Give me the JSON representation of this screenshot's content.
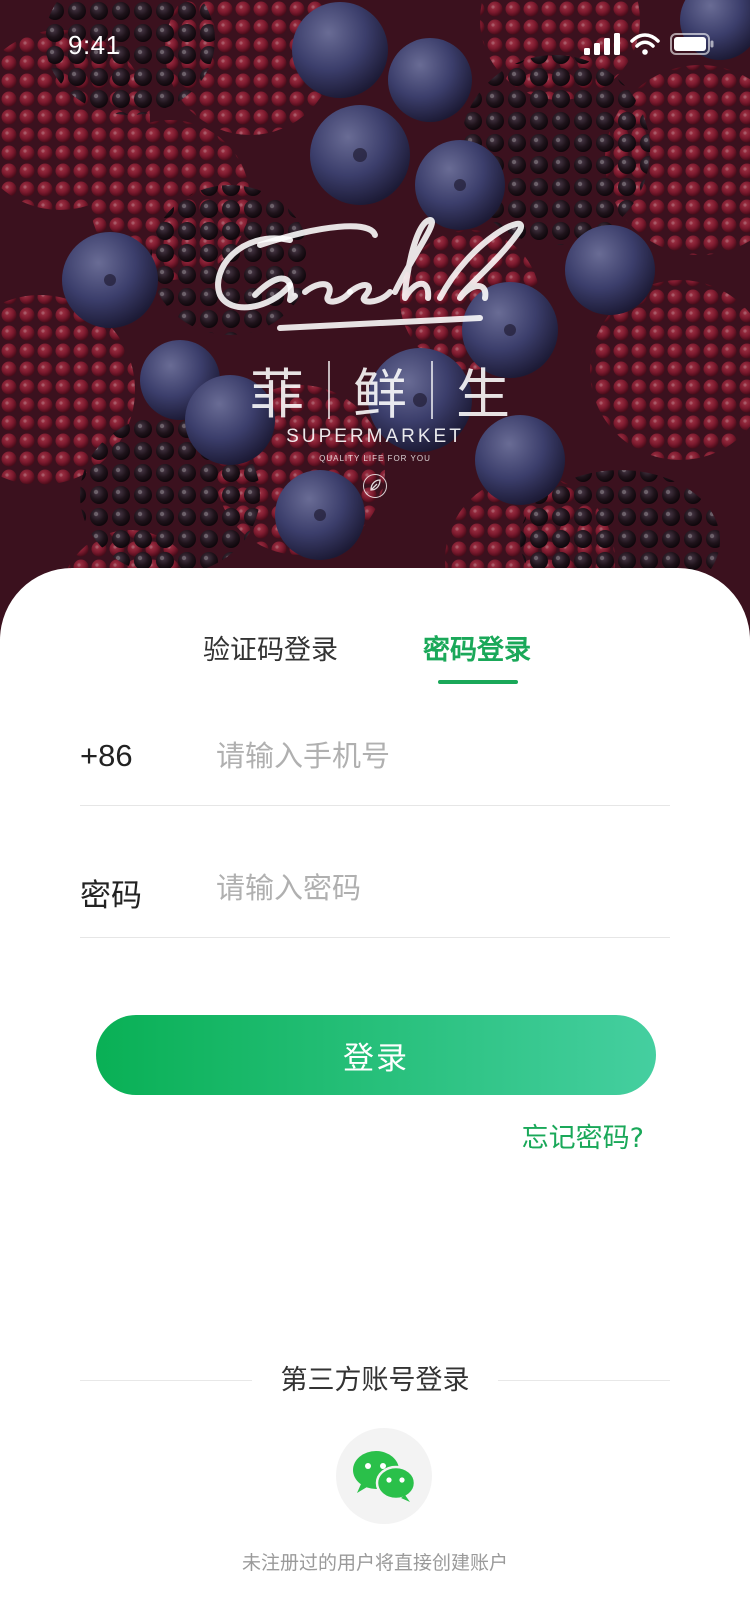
{
  "status_bar": {
    "time": "9:41"
  },
  "brand": {
    "script_name": "Freshlh",
    "cn_chars": [
      "菲",
      "鲜",
      "生"
    ],
    "supermarket": "SUPERMARKET",
    "tagline": "QUALITY LIFE FOR YOU"
  },
  "tabs": [
    {
      "label": "验证码登录",
      "active": false
    },
    {
      "label": "密码登录",
      "active": true
    }
  ],
  "form": {
    "phone_prefix": "+86",
    "phone_placeholder": "请输入手机号",
    "password_label": "密码",
    "password_placeholder": "请输入密码"
  },
  "login_button": "登录",
  "forgot_password": "忘记密码?",
  "third_party": {
    "title": "第三方账号登录",
    "wechat_icon": "wechat-icon"
  },
  "hint": "未注册过的用户将直接创建账户",
  "colors": {
    "accent": "#1aa859",
    "gradient_start": "#09b055",
    "gradient_end": "#45cfa0"
  }
}
